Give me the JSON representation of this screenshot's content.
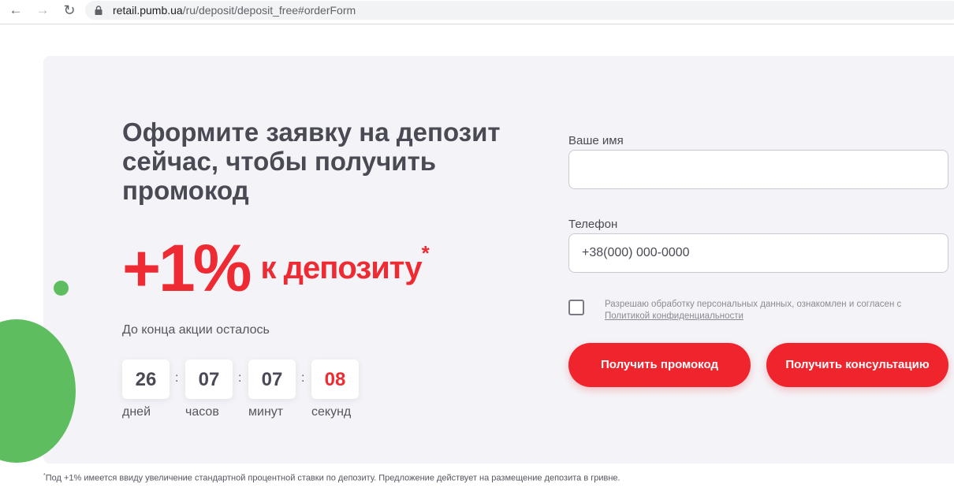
{
  "browser": {
    "url_host": "retail.pumb.ua",
    "url_path": "/ru/deposit/deposit_free#orderForm"
  },
  "hero": {
    "headline": "Оформите заявку на депозит сейчас, чтобы получить промокод",
    "promo_big": "+1%",
    "promo_small": "к депозиту",
    "promo_star": "*"
  },
  "timer": {
    "label": "До конца акции осталось",
    "days": "26",
    "days_label": "дней",
    "hours": "07",
    "hours_label": "часов",
    "minutes": "07",
    "minutes_label": "минут",
    "seconds": "08",
    "seconds_label": "секунд",
    "separator": ":"
  },
  "form": {
    "name_label": "Ваше имя",
    "name_value": "",
    "phone_label": "Телефон",
    "phone_placeholder": "+38(000) 000-0000",
    "consent_text": "Разрешаю обработку персональных данных, ознакомлен и согласен с",
    "consent_link": "Политикой конфиденциальности",
    "btn_promo": "Получить промокод",
    "btn_consult": "Получить консультацию"
  },
  "footnote": {
    "star": "*",
    "text": "Под +1% имеется ввиду увеличение стандартной процентной ставки по депозиту. Предложение действует на размещение депозита в гривне."
  },
  "colors": {
    "accent_red": "#ee2b32",
    "green": "#5ebd5f",
    "card_bg": "#f4f4f8"
  }
}
